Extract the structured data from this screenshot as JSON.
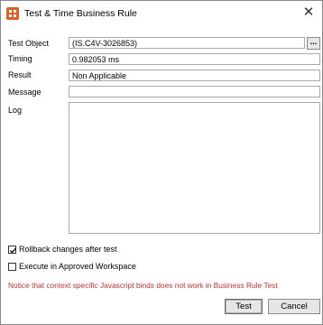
{
  "window": {
    "title": "Test & Time Business Rule",
    "close_glyph": "✕",
    "app_icon": "grid-app-icon"
  },
  "fields": {
    "test_object": {
      "label": "Test Object",
      "value": "(IS.C4V-3026853)",
      "browse_label": "..."
    },
    "timing": {
      "label": "Timing",
      "value": "0.982053 ms"
    },
    "result": {
      "label": "Result",
      "value": "Non Applicable"
    },
    "message": {
      "label": "Message",
      "value": ""
    },
    "log": {
      "label": "Log",
      "value": ""
    }
  },
  "options": {
    "rollback": {
      "label": "Rollback changes after test",
      "checked": true
    },
    "approved_workspace": {
      "label": "Execute in Approved Workspace",
      "checked": false
    }
  },
  "notice": "Notice that context specific Javascript binds does not work in Business Rule Test",
  "buttons": {
    "test": "Test",
    "cancel": "Cancel"
  },
  "colors": {
    "accent": "#e06023",
    "notice": "#d62b2b"
  }
}
